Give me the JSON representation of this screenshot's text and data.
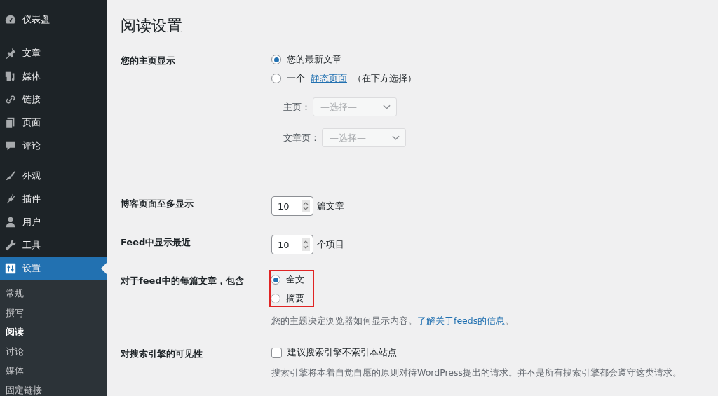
{
  "sidebar": {
    "groups": [
      [
        {
          "label": "仪表盘",
          "selected": false
        }
      ],
      [
        {
          "label": "文章",
          "selected": false
        },
        {
          "label": "媒体",
          "selected": false
        },
        {
          "label": "链接",
          "selected": false
        },
        {
          "label": "页面",
          "selected": false
        },
        {
          "label": "评论",
          "selected": false
        }
      ],
      [
        {
          "label": "外观",
          "selected": false
        },
        {
          "label": "插件",
          "selected": false
        },
        {
          "label": "用户",
          "selected": false
        },
        {
          "label": "工具",
          "selected": false
        },
        {
          "label": "设置",
          "selected": true
        }
      ]
    ],
    "submenu": [
      {
        "label": "常规",
        "selected": false
      },
      {
        "label": "撰写",
        "selected": false
      },
      {
        "label": "阅读",
        "selected": true
      },
      {
        "label": "讨论",
        "selected": false
      },
      {
        "label": "媒体",
        "selected": false
      },
      {
        "label": "固定链接",
        "selected": false
      }
    ]
  },
  "page_title": "阅读设置",
  "rows": [
    {
      "kind": "radios",
      "label": "您的主页显示",
      "options": [
        {
          "parts": [
            {
              "text": "您的最新文章"
            }
          ],
          "selected": true
        },
        {
          "parts": [
            {
              "text": "一个"
            },
            {
              "text": "静态页面",
              "link": true
            },
            {
              "text": "（在下方选择）"
            }
          ],
          "selected": false
        }
      ],
      "selects": [
        {
          "label": "主页：",
          "placeholder": "—选择—",
          "disabled": true
        },
        {
          "label": "文章页：",
          "placeholder": "—选择—",
          "disabled": true
        }
      ]
    },
    {
      "kind": "number",
      "label": "博客页面至多显示",
      "value": "10",
      "unit": "篇文章"
    },
    {
      "kind": "number",
      "label": "Feed中显示最近",
      "value": "10",
      "unit": "个项目"
    },
    {
      "kind": "radios",
      "label": "对于feed中的每篇文章，包含",
      "highlighted": true,
      "options": [
        {
          "parts": [
            {
              "text": "全文"
            }
          ],
          "selected": true
        },
        {
          "parts": [
            {
              "text": "摘要"
            }
          ],
          "selected": false
        }
      ],
      "help": [
        {
          "text": "您的主题决定浏览器如何显示内容。"
        },
        {
          "text": "了解关于feeds的信息",
          "link": true
        },
        {
          "text": "。"
        }
      ]
    },
    {
      "kind": "checkbox",
      "label": "对搜索引擎的可见性",
      "option": "建议搜索引擎不索引本站点",
      "checked": false,
      "help": [
        {
          "text": "搜索引擎将本着自觉自愿的原则对待WordPress提出的请求。并不是所有搜索引擎都会遵守这类请求。"
        }
      ]
    }
  ]
}
